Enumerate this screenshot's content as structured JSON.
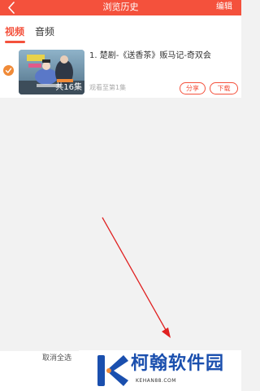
{
  "header": {
    "back_icon": "chevron-left-icon",
    "title": "浏览历史",
    "edit_label": "编辑"
  },
  "tabs": [
    {
      "label": "视频",
      "active": true
    },
    {
      "label": "音频",
      "active": false
    }
  ],
  "history_items": [
    {
      "selected": true,
      "thumbnail_badge": "共16集",
      "title": "1. 楚剧-《送香茶》贩马记-奇双会",
      "progress": "观看至第1集",
      "share_label": "分享",
      "download_label": "下载"
    }
  ],
  "bottom_bar": {
    "cancel_all_label": "取消全选"
  },
  "watermark": {
    "name": "柯翰软件园",
    "url": "KEHAN88.COM"
  },
  "colors": {
    "accent": "#f4513c",
    "check": "#f08a37",
    "watermark_blue": "#1a4fae",
    "arrow": "#e02020"
  }
}
